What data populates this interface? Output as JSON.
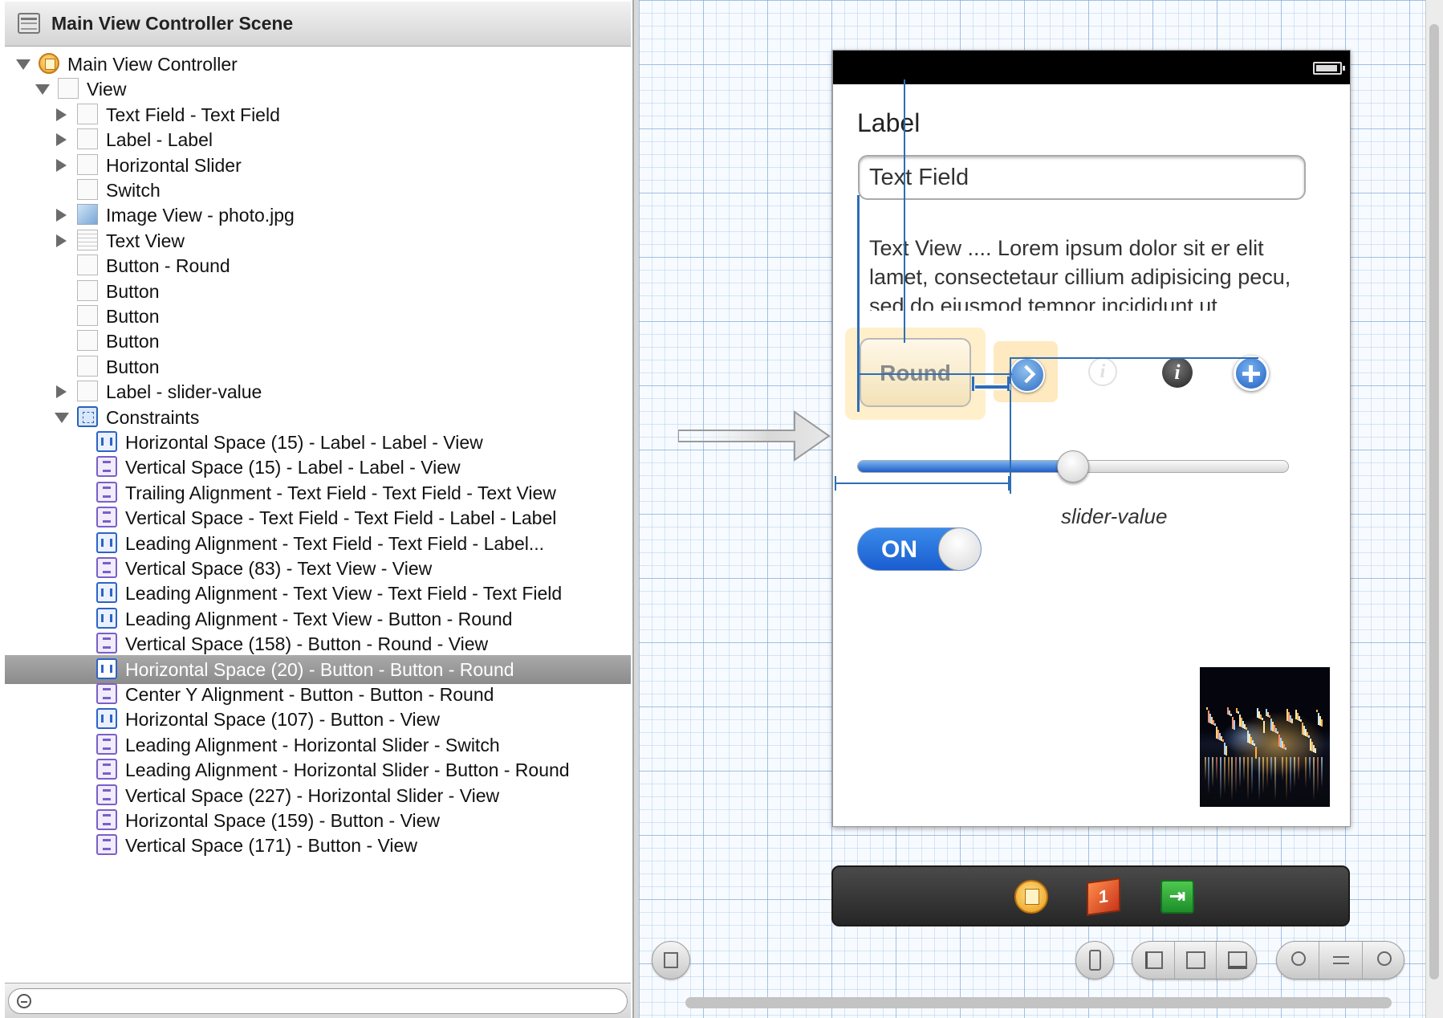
{
  "outline": {
    "header_title": "Main View Controller Scene",
    "items": [
      {
        "label": "Main View Controller",
        "depth": 0,
        "disclosure": "open",
        "icon": "view-controller-icon"
      },
      {
        "label": "View",
        "depth": 1,
        "disclosure": "open",
        "icon": "view-icon"
      },
      {
        "label": "Text Field - Text Field",
        "depth": 2,
        "disclosure": "closed",
        "icon": "text-field-icon"
      },
      {
        "label": "Label - Label",
        "depth": 2,
        "disclosure": "closed",
        "icon": "label-icon"
      },
      {
        "label": "Horizontal Slider",
        "depth": 2,
        "disclosure": "closed",
        "icon": "slider-icon"
      },
      {
        "label": "Switch",
        "depth": 2,
        "disclosure": "none",
        "icon": "switch-icon"
      },
      {
        "label": "Image View - photo.jpg",
        "depth": 2,
        "disclosure": "closed",
        "icon": "image-view-icon"
      },
      {
        "label": "Text View",
        "depth": 2,
        "disclosure": "closed",
        "icon": "text-view-icon"
      },
      {
        "label": "Button - Round",
        "depth": 2,
        "disclosure": "none",
        "icon": "button-icon"
      },
      {
        "label": "Button",
        "depth": 2,
        "disclosure": "none",
        "icon": "button-icon"
      },
      {
        "label": "Button",
        "depth": 2,
        "disclosure": "none",
        "icon": "button-icon"
      },
      {
        "label": "Button",
        "depth": 2,
        "disclosure": "none",
        "icon": "button-icon"
      },
      {
        "label": "Button",
        "depth": 2,
        "disclosure": "none",
        "icon": "button-icon"
      },
      {
        "label": "Label - slider-value",
        "depth": 2,
        "disclosure": "closed",
        "icon": "label-icon"
      },
      {
        "label": "Constraints",
        "depth": 2,
        "disclosure": "open",
        "icon": "constraints-icon"
      },
      {
        "label": "Horizontal Space (15) - Label - Label - View",
        "depth": 3,
        "disclosure": "none",
        "icon": "horizontal-constraint-icon"
      },
      {
        "label": "Vertical Space (15) - Label - Label - View",
        "depth": 3,
        "disclosure": "none",
        "icon": "vertical-constraint-icon"
      },
      {
        "label": "Trailing Alignment - Text Field - Text Field - Text View",
        "depth": 3,
        "disclosure": "none",
        "icon": "vertical-constraint-icon"
      },
      {
        "label": "Vertical Space - Text Field - Text Field - Label - Label",
        "depth": 3,
        "disclosure": "none",
        "icon": "vertical-constraint-icon"
      },
      {
        "label": "Leading Alignment - Text Field - Text Field - Label...",
        "depth": 3,
        "disclosure": "none",
        "icon": "horizontal-constraint-icon"
      },
      {
        "label": "Vertical Space (83) - Text View - View",
        "depth": 3,
        "disclosure": "none",
        "icon": "vertical-constraint-icon"
      },
      {
        "label": "Leading Alignment - Text View - Text Field - Text Field",
        "depth": 3,
        "disclosure": "none",
        "icon": "horizontal-constraint-icon"
      },
      {
        "label": "Leading Alignment - Text View - Button - Round",
        "depth": 3,
        "disclosure": "none",
        "icon": "horizontal-constraint-icon"
      },
      {
        "label": "Vertical Space (158) - Button - Round - View",
        "depth": 3,
        "disclosure": "none",
        "icon": "vertical-constraint-icon"
      },
      {
        "label": "Horizontal Space (20) - Button - Button - Round",
        "depth": 3,
        "disclosure": "none",
        "icon": "horizontal-constraint-icon",
        "selected": true
      },
      {
        "label": "Center Y Alignment - Button - Button - Round",
        "depth": 3,
        "disclosure": "none",
        "icon": "vertical-constraint-icon"
      },
      {
        "label": "Horizontal Space (107) - Button - View",
        "depth": 3,
        "disclosure": "none",
        "icon": "horizontal-constraint-icon"
      },
      {
        "label": "Leading Alignment - Horizontal Slider - Switch",
        "depth": 3,
        "disclosure": "none",
        "icon": "vertical-constraint-icon"
      },
      {
        "label": "Leading Alignment - Horizontal Slider - Button - Round",
        "depth": 3,
        "disclosure": "none",
        "icon": "vertical-constraint-icon"
      },
      {
        "label": "Vertical Space (227) - Horizontal Slider - View",
        "depth": 3,
        "disclosure": "none",
        "icon": "vertical-constraint-icon"
      },
      {
        "label": "Horizontal Space (159) - Button - View",
        "depth": 3,
        "disclosure": "none",
        "icon": "vertical-constraint-icon"
      },
      {
        "label": "Vertical Space (171) - Button - View",
        "depth": 3,
        "disclosure": "none",
        "icon": "vertical-constraint-icon"
      }
    ],
    "filter_placeholder": ""
  },
  "canvas": {
    "device": {
      "label_text": "Label",
      "text_field_text": "Text Field",
      "text_view_text": "Text View .... Lorem ipsum dolor sit er elit lamet, consectetaur cillium adipisicing pecu, sed do eiusmod tempor incididunt ut",
      "round_button_title": "Round",
      "slider_value_label": "slider-value",
      "slider_fraction": 0.5,
      "switch_text": "ON",
      "switch_on": true,
      "info_symbol": "i"
    },
    "dock": {
      "first_responder_glyph": "1",
      "exit_glyph": "⇥"
    }
  },
  "colors": {
    "selection": "#999999",
    "constraint_guide": "#2f6db5",
    "accent_blue": "#1f5fc7"
  }
}
